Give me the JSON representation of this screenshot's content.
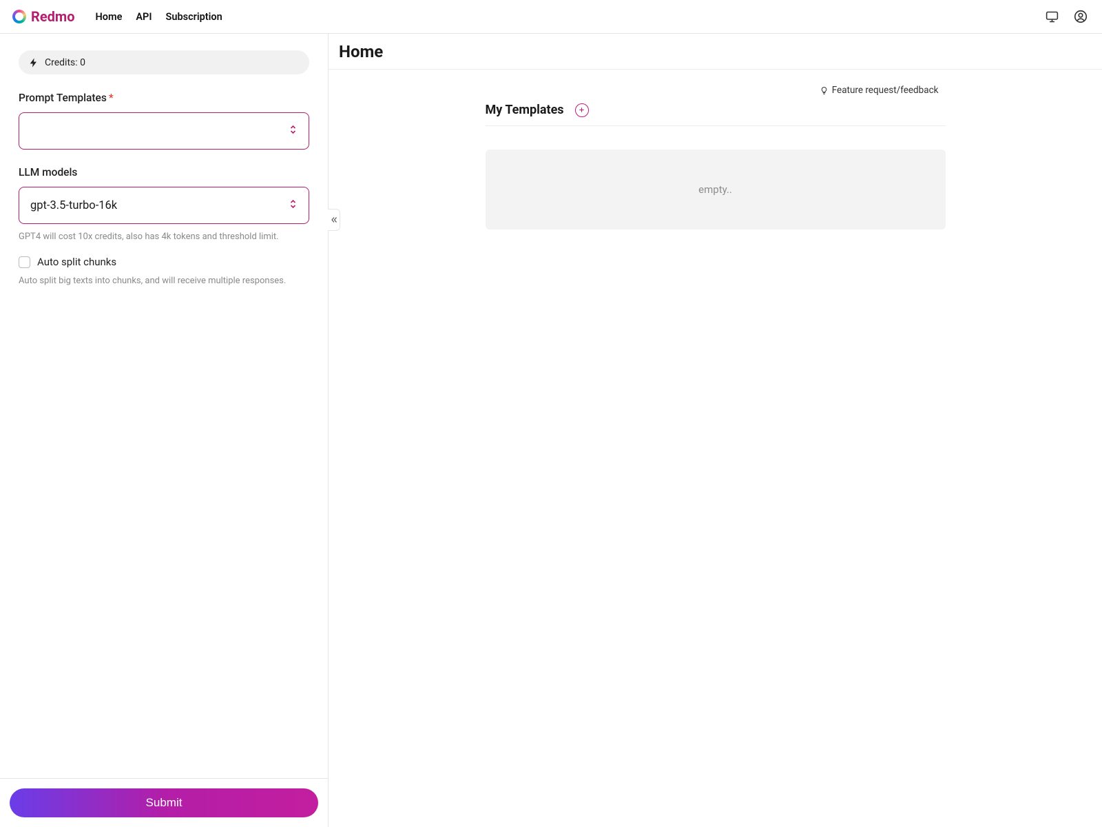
{
  "brand": {
    "name": "Redmo"
  },
  "nav": {
    "home": "Home",
    "api": "API",
    "subscription": "Subscription"
  },
  "sidebar": {
    "credits_label": "Credits: 0",
    "prompt_templates_label": "Prompt Templates",
    "prompt_templates_value": "",
    "llm_label": "LLM models",
    "llm_value": "gpt-3.5-turbo-16k",
    "llm_hint": "GPT4 will cost 10x credits, also has 4k tokens and threshold limit.",
    "split_label": "Auto split chunks",
    "split_hint": "Auto split big texts into chunks, and will receive multiple responses.",
    "submit": "Submit"
  },
  "main": {
    "title": "Home",
    "feedback": "Feature request/feedback",
    "section": "My Templates",
    "empty": "empty.."
  }
}
